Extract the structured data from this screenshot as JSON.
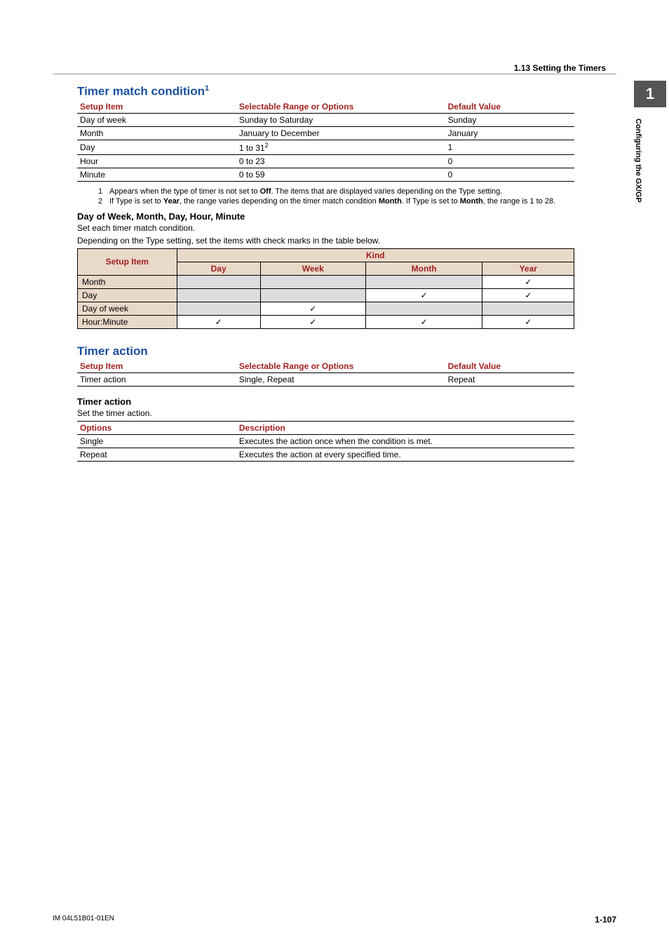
{
  "header": {
    "section": "1.13  Setting the Timers"
  },
  "sidetab": {
    "chapter": "1",
    "text": "Configuring the GX/GP"
  },
  "match": {
    "title": "Timer match condition",
    "sup": "1",
    "cols": {
      "c1": "Setup Item",
      "c2": "Selectable Range or Options",
      "c3": "Default Value"
    },
    "rows": [
      {
        "c1": "Day of week",
        "c2": "Sunday to Saturday",
        "c3": "Sunday"
      },
      {
        "c1": "Month",
        "c2": "January to December",
        "c3": "January"
      },
      {
        "c1": "Day",
        "c2": "1 to 31",
        "c2sup": "2",
        "c3": "1"
      },
      {
        "c1": "Hour",
        "c2": "0 to 23",
        "c3": "0"
      },
      {
        "c1": "Minute",
        "c2": "0 to 59",
        "c3": "0"
      }
    ],
    "notes": [
      {
        "n": "1",
        "t_a": "Appears when the type of timer is not set to ",
        "t_b": "Off",
        "t_c": ". The items that are displayed varies depending on the Type setting."
      },
      {
        "n": "2",
        "t_a": "If Type is set to ",
        "t_b": "Year",
        "t_c": ", the range varies depending on the timer match condition ",
        "t_d": "Month",
        "t_e": ". If Type is set to ",
        "t_f": "Month",
        "t_g": ", the range is 1 to 28."
      }
    ],
    "subhead": "Day of Week, Month, Day, Hour, Minute",
    "p1": "Set each timer match condition.",
    "p2": "Depending on the Type setting, set the items with check marks in the table below.",
    "kind": {
      "header_setup": "Setup Item",
      "header_kind": "Kind",
      "cols": [
        "Day",
        "Week",
        "Month",
        "Year"
      ],
      "rows": [
        {
          "label": "Month",
          "cells": [
            "g",
            "g",
            "g",
            "c"
          ]
        },
        {
          "label": "Day",
          "cells": [
            "g",
            "g",
            "c",
            "c"
          ]
        },
        {
          "label": "Day of week",
          "cells": [
            "g",
            "c",
            "g",
            "g"
          ]
        },
        {
          "label": "Hour:Minute",
          "cells": [
            "c",
            "c",
            "c",
            "c"
          ]
        }
      ]
    }
  },
  "action": {
    "title": "Timer action",
    "cols": {
      "c1": "Setup Item",
      "c2": "Selectable Range or Options",
      "c3": "Default Value"
    },
    "row": {
      "c1": "Timer action",
      "c2": "Single, Repeat",
      "c3": "Repeat"
    },
    "subhead": "Timer action",
    "p1": "Set the timer action.",
    "opts": {
      "h1": "Options",
      "h2": "Description",
      "rows": [
        {
          "c1": "Single",
          "c2": "Executes the action once when the condition is met."
        },
        {
          "c1": "Repeat",
          "c2": "Executes the action at every specified time."
        }
      ]
    }
  },
  "footer": {
    "left": "IM 04L51B01-01EN",
    "right": "1-107"
  },
  "glyph": {
    "check": "✓"
  }
}
